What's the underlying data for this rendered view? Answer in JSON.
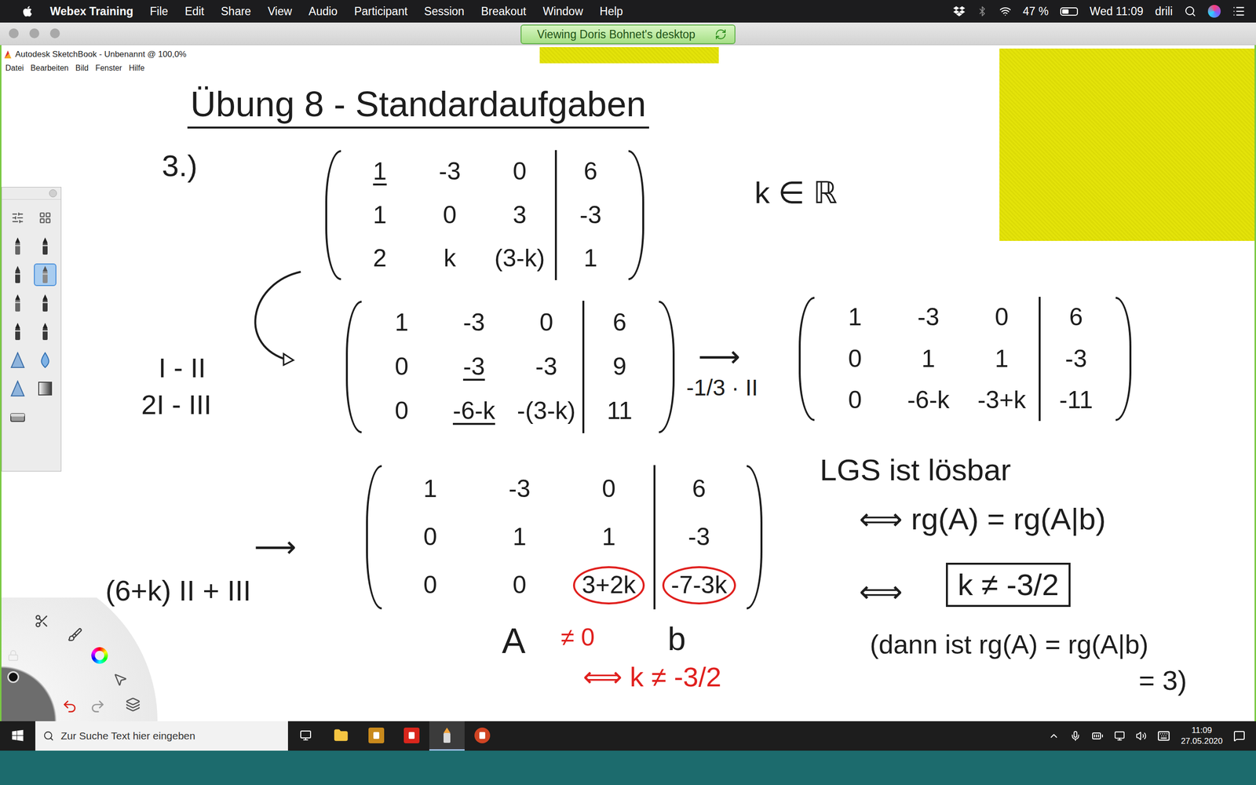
{
  "menubar": {
    "app": "Webex Training",
    "menus": [
      "File",
      "Edit",
      "Share",
      "View",
      "Audio",
      "Participant",
      "Session",
      "Breakout",
      "Window",
      "Help"
    ],
    "battery_text": "47 %",
    "battery_level": 0.47,
    "clock": "Wed 11:09",
    "user": "drili"
  },
  "webex": {
    "banner": "Viewing Doris Bohnet's desktop"
  },
  "sketchbook": {
    "title": "Autodesk SketchBook - Unbenannt @ 100,0%",
    "menus": [
      "Datei",
      "Bearbeiten",
      "Bild",
      "Fenster",
      "Hilfe"
    ]
  },
  "tool_palette": {
    "tools": [
      {
        "kind": "settings",
        "selected": false
      },
      {
        "kind": "layout",
        "selected": false
      },
      {
        "kind": "pencil",
        "selected": false
      },
      {
        "kind": "pen",
        "selected": false
      },
      {
        "kind": "marker",
        "selected": false
      },
      {
        "kind": "brush",
        "selected": true
      },
      {
        "kind": "pencil",
        "selected": false
      },
      {
        "kind": "pen",
        "selected": false
      },
      {
        "kind": "pen",
        "selected": false
      },
      {
        "kind": "pen",
        "selected": false
      },
      {
        "kind": "triangle",
        "selected": false
      },
      {
        "kind": "drop",
        "selected": false
      },
      {
        "kind": "triangle",
        "selected": false
      },
      {
        "kind": "gradient",
        "selected": false
      },
      {
        "kind": "eraser",
        "selected": false
      }
    ]
  },
  "canvas": {
    "heading": "Übung 8 - Standardaufgaben",
    "matrices": [
      {
        "rows": [
          [
            "1",
            "-3",
            "0",
            "6"
          ],
          [
            "1",
            "0",
            "3",
            "-3"
          ],
          [
            "2",
            "k",
            "(3-k)",
            "1"
          ]
        ],
        "underlined": [
          [
            0,
            0
          ]
        ],
        "circled": []
      },
      {
        "rows": [
          [
            "1",
            "-3",
            "0",
            "6"
          ],
          [
            "0",
            "-3",
            "-3",
            "9"
          ],
          [
            "0",
            "-6-k",
            "-(3-k)",
            "11"
          ]
        ],
        "underlined": [
          [
            1,
            1
          ],
          [
            2,
            1
          ]
        ],
        "circled": []
      },
      {
        "rows": [
          [
            "1",
            "-3",
            "0",
            "6"
          ],
          [
            "0",
            "1",
            "1",
            "-3"
          ],
          [
            "0",
            "-6-k",
            "-3+k",
            "-11"
          ]
        ],
        "underlined": [],
        "circled": []
      },
      {
        "rows": [
          [
            "1",
            "-3",
            "0",
            "6"
          ],
          [
            "0",
            "1",
            "1",
            "-3"
          ],
          [
            "0",
            "0",
            "3+2k",
            "-7-3k"
          ]
        ],
        "underlined": [],
        "circled": [
          [
            2,
            2
          ],
          [
            2,
            3
          ]
        ]
      }
    ],
    "notes": [
      {
        "text": "3.)",
        "color": "#1d1d1d",
        "boxed": false
      },
      {
        "text": "k ∈ ℝ",
        "color": "#1d1d1d",
        "boxed": false
      },
      {
        "text": "I - II",
        "color": "#1d1d1d",
        "boxed": false
      },
      {
        "text": "2I - III",
        "color": "#1d1d1d",
        "boxed": false
      },
      {
        "text": "⟶",
        "color": "#1d1d1d",
        "boxed": false
      },
      {
        "text": "-1/3 · II",
        "color": "#1d1d1d",
        "boxed": false
      },
      {
        "text": "⟶",
        "color": "#1d1d1d",
        "boxed": false
      },
      {
        "text": "(6+k) II  +  III",
        "color": "#1d1d1d",
        "boxed": false
      },
      {
        "text": "A",
        "color": "#1d1d1d",
        "boxed": false
      },
      {
        "text": "≠ 0",
        "color": "#e0201e",
        "boxed": false
      },
      {
        "text": "b",
        "color": "#1d1d1d",
        "boxed": false
      },
      {
        "text": "⟺ k ≠ -3/2",
        "color": "#e0201e",
        "boxed": false
      },
      {
        "text": "LGS ist lösbar",
        "color": "#1d1d1d",
        "boxed": false
      },
      {
        "text": "⟺ rg(A) = rg(A|b)",
        "color": "#1d1d1d",
        "boxed": false
      },
      {
        "text": "⟺",
        "color": "#1d1d1d",
        "boxed": false
      },
      {
        "text": "k ≠ -3/2",
        "color": "#1d1d1d",
        "boxed": true
      },
      {
        "text": "(dann ist rg(A) = rg(A|b)",
        "color": "#1d1d1d",
        "boxed": false
      },
      {
        "text": "= 3)",
        "color": "#1d1d1d",
        "boxed": false
      }
    ]
  },
  "taskbar": {
    "search_placeholder": "Zur Suche Text hier eingeben",
    "time": "11:09",
    "date": "27.05.2020",
    "apps": [
      {
        "kind": "explorer",
        "selected": false
      },
      {
        "kind": "txc",
        "selected": false
      },
      {
        "kind": "pdf",
        "selected": false
      },
      {
        "kind": "sketchbook",
        "selected": true
      },
      {
        "kind": "powerpoint",
        "selected": false
      }
    ]
  }
}
